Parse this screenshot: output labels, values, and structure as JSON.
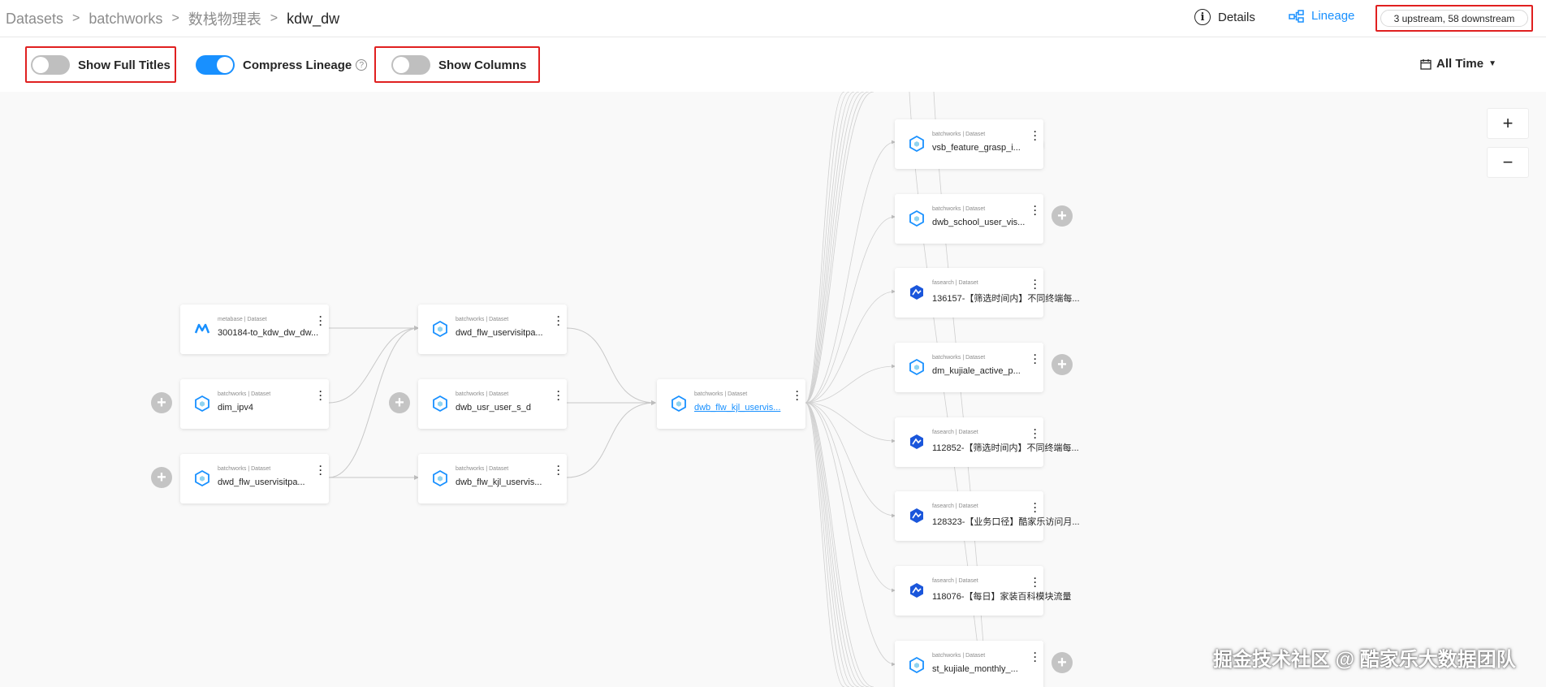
{
  "breadcrumb": {
    "items": [
      "Datasets",
      "batchworks",
      "数栈物理表"
    ],
    "separator": ">",
    "current": "kdw_dw"
  },
  "header": {
    "details_label": "Details",
    "lineage_label": "Lineage",
    "lineage_count": "3 upstream, 58 downstream"
  },
  "toolbar": {
    "show_full_titles_label": "Show Full Titles",
    "show_full_titles_on": false,
    "compress_lineage_label": "Compress Lineage",
    "compress_lineage_on": true,
    "show_columns_label": "Show Columns",
    "show_columns_on": false,
    "time_filter_label": "All Time"
  },
  "zoom": {
    "in_label": "+",
    "out_label": "−"
  },
  "colors": {
    "accent": "#1890ff",
    "highlight_box": "#e02020",
    "switch_off": "#bfbfbf"
  },
  "nodes": {
    "up1": {
      "platform": "metabase",
      "type": "Dataset",
      "title": "300184-to_kdw_dw_dw..."
    },
    "up2": {
      "platform": "batchworks",
      "type": "Dataset",
      "title": "dim_ipv4"
    },
    "up3": {
      "platform": "batchworks",
      "type": "Dataset",
      "title": "dwd_flw_uservisitpa..."
    },
    "mid1": {
      "platform": "batchworks",
      "type": "Dataset",
      "title": "dwd_flw_uservisitpa..."
    },
    "mid2": {
      "platform": "batchworks",
      "type": "Dataset",
      "title": "dwb_usr_user_s_d"
    },
    "mid3": {
      "platform": "batchworks",
      "type": "Dataset",
      "title": "dwb_flw_kjl_uservis..."
    },
    "focus": {
      "platform": "batchworks",
      "type": "Dataset",
      "title": "dwb_flw_kjl_uservis..."
    },
    "down1": {
      "platform": "batchworks",
      "type": "Dataset",
      "title": "vsb_feature_grasp_i..."
    },
    "down2": {
      "platform": "batchworks",
      "type": "Dataset",
      "title": "dwb_school_user_vis..."
    },
    "down3": {
      "platform": "fasearch",
      "type": "Dataset",
      "title": "136157-【筛选时间内】不同终端每..."
    },
    "down4": {
      "platform": "batchworks",
      "type": "Dataset",
      "title": "dm_kujiale_active_p..."
    },
    "down5": {
      "platform": "fasearch",
      "type": "Dataset",
      "title": "112852-【筛选时间内】不同终端每..."
    },
    "down6": {
      "platform": "fasearch",
      "type": "Dataset",
      "title": "128323-【业务口径】酷家乐访问月..."
    },
    "down7": {
      "platform": "fasearch",
      "type": "Dataset",
      "title": "118076-【每日】家装百科模块流量"
    },
    "down8": {
      "platform": "batchworks",
      "type": "Dataset",
      "title": "st_kujiale_monthly_..."
    }
  },
  "watermark": "掘金技术社区 @ 酷家乐大数据团队",
  "icons": [
    "info-icon",
    "lineage-icon",
    "calendar-icon",
    "question-icon",
    "dataset-hex-icon",
    "metabase-icon",
    "fasearch-icon",
    "more-vertical-icon",
    "plus-icon"
  ]
}
